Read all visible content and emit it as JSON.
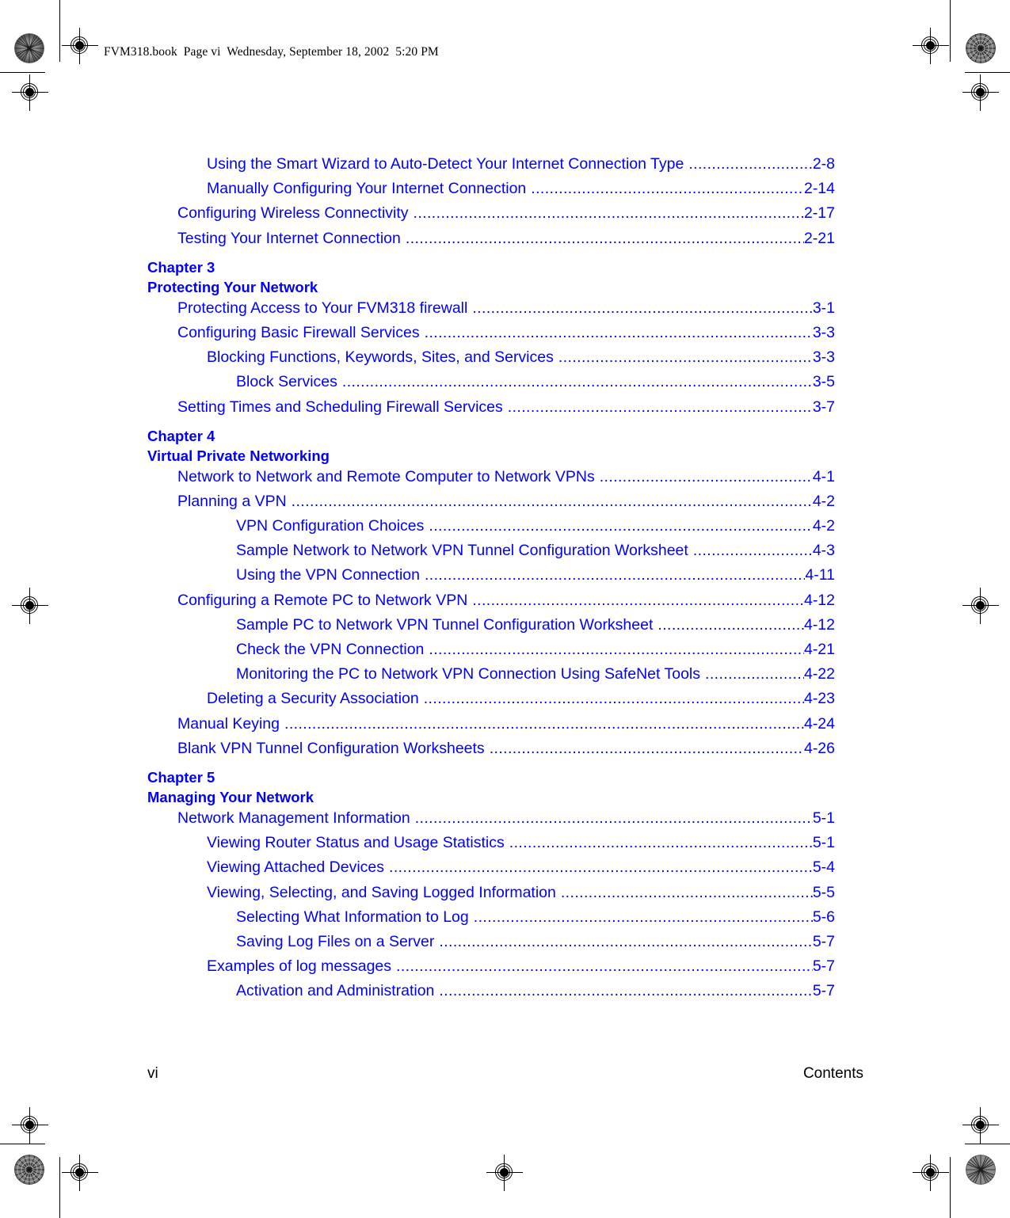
{
  "header": {
    "file_line": "FVM318.book  Page vi  Wednesday, September 18, 2002  5:20 PM"
  },
  "colors": {
    "link_blue": "#0000FF",
    "text_black": "#000000",
    "page_background": "#FFFFFF"
  },
  "toc": {
    "entries": [
      {
        "level": 2,
        "title": "Using the Smart Wizard to Auto-Detect Your Internet Connection Type",
        "page": "2-8"
      },
      {
        "level": 2,
        "title": "Manually Configuring Your Internet Connection",
        "page": "2-14"
      },
      {
        "level": 1,
        "title": "Configuring Wireless Connectivity",
        "page": "2-17"
      },
      {
        "level": 1,
        "title": "Testing Your Internet Connection",
        "page": "2-21"
      },
      {
        "type": "chapter",
        "number": "Chapter 3",
        "name": "Protecting Your Network"
      },
      {
        "level": 1,
        "title": "Protecting Access to Your FVM318 firewall",
        "page": "3-1"
      },
      {
        "level": 1,
        "title": "Configuring Basic Firewall Services",
        "page": "3-3"
      },
      {
        "level": 2,
        "title": "Blocking Functions, Keywords, Sites, and Services",
        "page": "3-3"
      },
      {
        "level": 3,
        "title": "Block Services",
        "page": "3-5"
      },
      {
        "level": 1,
        "title": "Setting Times and Scheduling Firewall Services",
        "page": "3-7"
      },
      {
        "type": "chapter",
        "number": "Chapter 4",
        "name": "Virtual Private Networking"
      },
      {
        "level": 1,
        "title": "Network to Network and Remote Computer to Network VPNs",
        "page": "4-1"
      },
      {
        "level": 1,
        "title": "Planning a VPN",
        "page": "4-2"
      },
      {
        "level": 3,
        "title": "VPN Configuration Choices",
        "page": "4-2"
      },
      {
        "level": 3,
        "title": "Sample Network to Network VPN Tunnel Configuration Worksheet",
        "page": "4-3"
      },
      {
        "level": 3,
        "title": "Using the VPN Connection",
        "page": "4-11"
      },
      {
        "level": 1,
        "title": "Configuring a Remote PC to Network VPN",
        "page": "4-12"
      },
      {
        "level": 3,
        "title": "Sample PC to Network VPN Tunnel Configuration Worksheet",
        "page": "4-12"
      },
      {
        "level": 3,
        "title": "Check the VPN Connection",
        "page": "4-21"
      },
      {
        "level": 3,
        "title": "Monitoring the PC to Network VPN Connection Using SafeNet Tools",
        "page": "4-22"
      },
      {
        "level": 2,
        "title": "Deleting a Security Association",
        "page": "4-23"
      },
      {
        "level": 1,
        "title": "Manual Keying",
        "page": "4-24"
      },
      {
        "level": 1,
        "title": "Blank VPN Tunnel Configuration Worksheets",
        "page": "4-26"
      },
      {
        "type": "chapter",
        "number": "Chapter 5",
        "name": "Managing Your Network"
      },
      {
        "level": 1,
        "title": "Network Management Information",
        "page": "5-1"
      },
      {
        "level": 2,
        "title": "Viewing Router Status and Usage Statistics",
        "page": "5-1"
      },
      {
        "level": 2,
        "title": "Viewing Attached Devices",
        "page": "5-4"
      },
      {
        "level": 2,
        "title": "Viewing, Selecting, and Saving Logged Information",
        "page": "5-5"
      },
      {
        "level": 3,
        "title": "Selecting What Information to Log",
        "page": "5-6"
      },
      {
        "level": 3,
        "title": "Saving Log Files on a Server",
        "page": "5-7"
      },
      {
        "level": 2,
        "title": "Examples of log messages",
        "page": "5-7"
      },
      {
        "level": 3,
        "title": "Activation and Administration",
        "page": "5-7"
      }
    ]
  },
  "footer": {
    "page_number": "vi",
    "section_label": "Contents"
  }
}
